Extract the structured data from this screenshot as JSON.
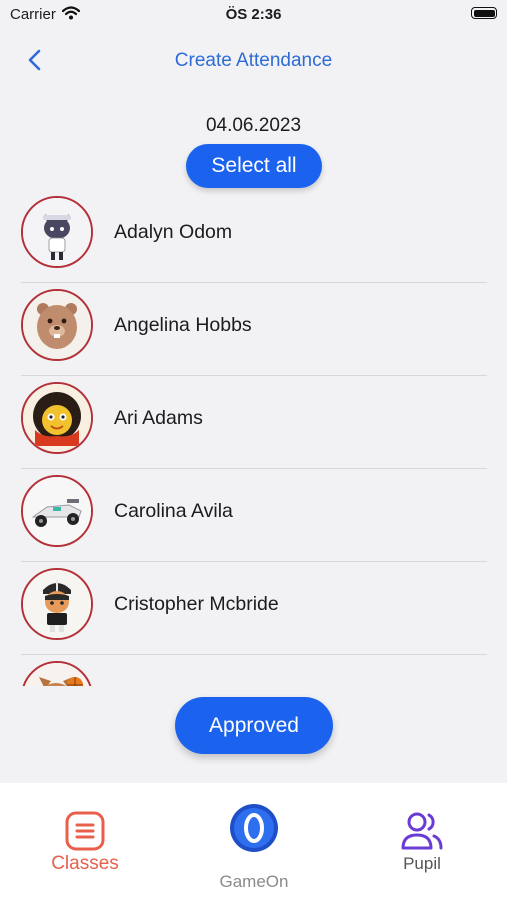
{
  "status_bar": {
    "carrier": "Carrier",
    "time": "ÖS 2:36"
  },
  "nav": {
    "title": "Create Attendance",
    "back_icon": "chevron-left-icon"
  },
  "date": "04.06.2023",
  "select_all_label": "Select all",
  "students": [
    {
      "name": "Adalyn Odom",
      "avatar": "cat-girl-avatar"
    },
    {
      "name": "Angelina Hobbs",
      "avatar": "bear-avatar"
    },
    {
      "name": "Ari Adams",
      "avatar": "lion-boy-avatar"
    },
    {
      "name": "Carolina Avila",
      "avatar": "race-car-avatar"
    },
    {
      "name": "Cristopher Mcbride",
      "avatar": "cap-boy-avatar"
    },
    {
      "name": "",
      "avatar": "fox-basketball-avatar"
    }
  ],
  "approved_label": "Approved",
  "tab_bar": {
    "classes": {
      "label": "Classes",
      "color": "#e8604c"
    },
    "gameon": {
      "label": "GameOn",
      "color": "#8a8a8e"
    },
    "pupil": {
      "label": "Pupil",
      "color": "#6b3bd6"
    }
  },
  "colors": {
    "accent": "#1b63ee",
    "title": "#2d6bd6",
    "avatar_border": "#b3323a"
  }
}
